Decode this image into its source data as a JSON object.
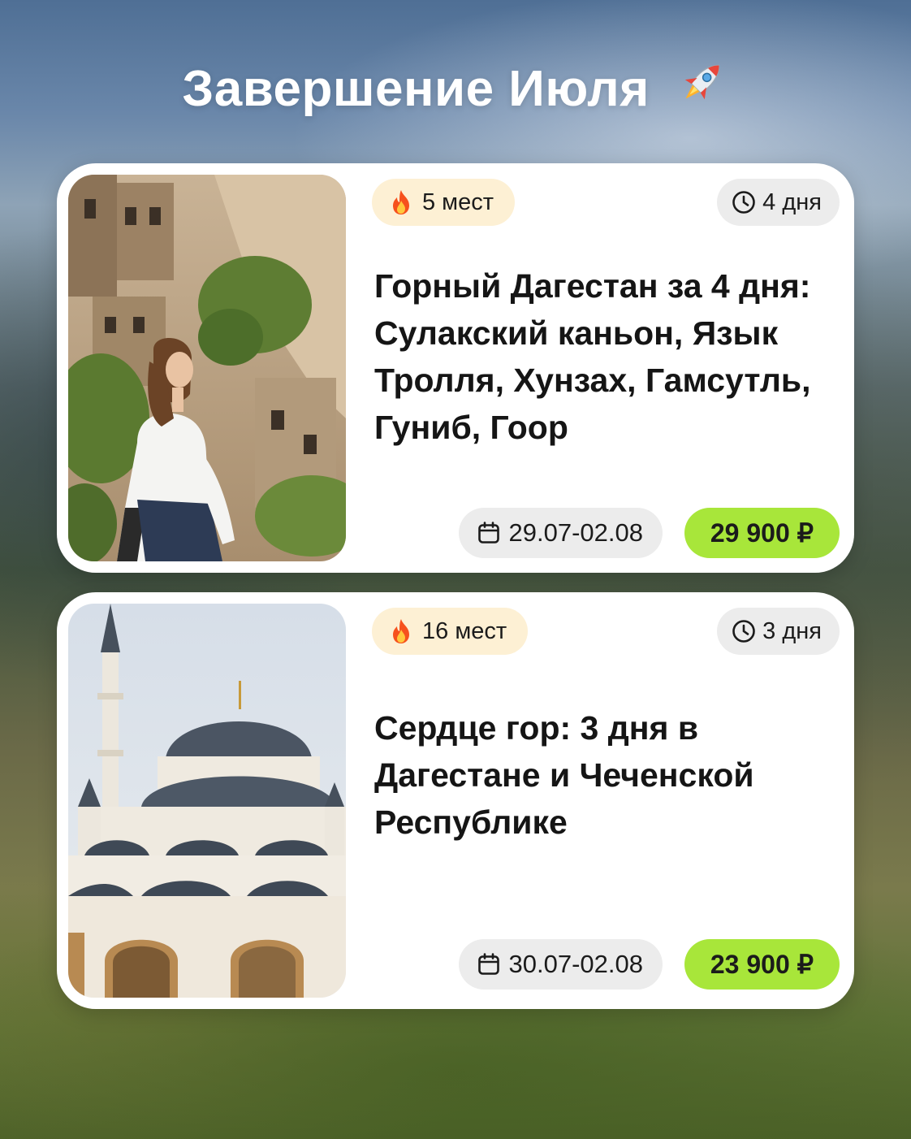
{
  "header": {
    "title": "Завершение Июля",
    "title_icon": "rocket-icon"
  },
  "tours": [
    {
      "spots": "5 мест",
      "duration": "4 дня",
      "title": "Горный Дагестан за 4 дня: Сулакский каньон, Язык Тролля, Хунзах, Гамсутль, Гуниб, Гоор",
      "dates": "29.07-02.08",
      "price": "29 900 ₽",
      "photo_icon": "photo-woman-ancient-ruins"
    },
    {
      "spots": "16 мест",
      "duration": "3 дня",
      "title": "Сердце гор: 3 дня в Дагестане и Чеченской Республике",
      "dates": "30.07-02.08",
      "price": "23 900 ₽",
      "photo_icon": "photo-mosque"
    }
  ],
  "colors": {
    "price_bg": "#a8e63a",
    "spots_bg": "#fdf0d4",
    "chip_bg": "#ececec",
    "card_bg": "#ffffff",
    "title_text": "#ffffff"
  }
}
